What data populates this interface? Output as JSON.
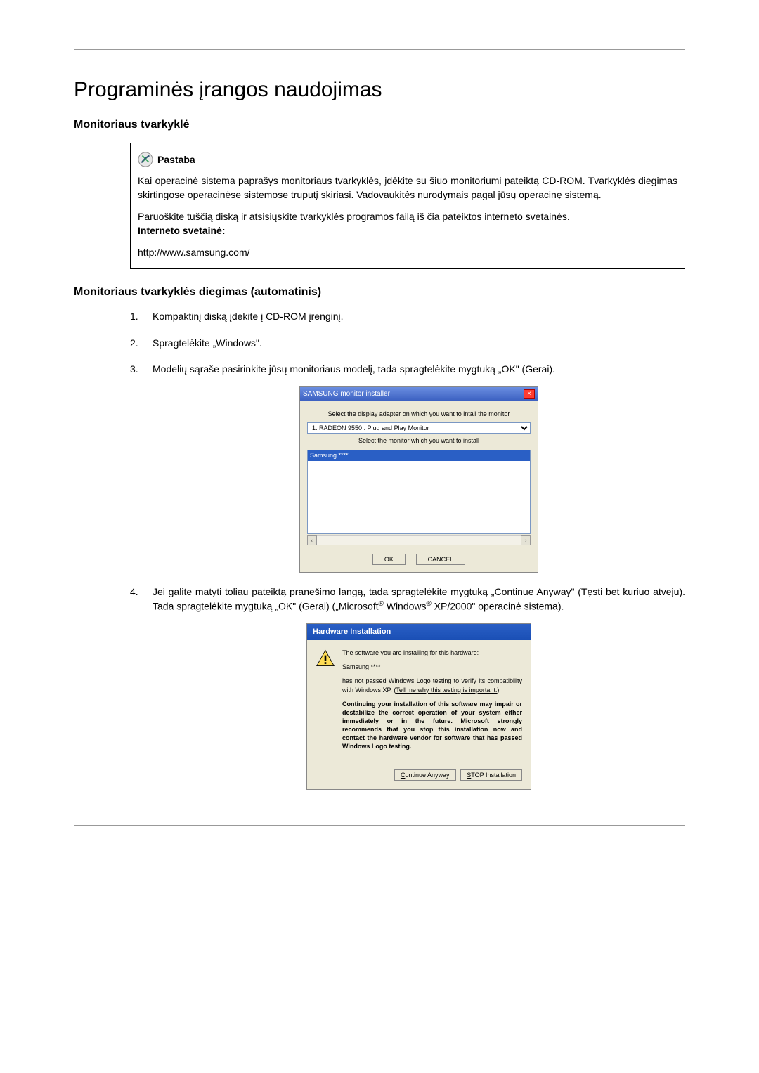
{
  "page_title": "Programinės įrangos naudojimas",
  "section1_heading": "Monitoriaus tvarkyklė",
  "note": {
    "title": "Pastaba",
    "para1": "Kai operacinė sistema paprašys monitoriaus tvarkyklės, įdėkite su šiuo monitoriumi pateiktą CD-ROM. Tvarkyklės diegimas skirtingose operacinėse sistemose truputį skiriasi. Vadovaukitės nurodymais pagal jūsų operacinę sistemą.",
    "para2": "Paruoškite tuščią diską ir atsisiųskite tvarkyklės programos failą iš čia pateiktos interneto svetainės.",
    "website_label": "Interneto svetainė:",
    "website_url": "http://www.samsung.com/"
  },
  "section2_heading": "Monitoriaus tvarkyklės diegimas (automatinis)",
  "steps": {
    "s1": "Kompaktinį diską įdėkite į CD-ROM įrenginį.",
    "s2": "Spragtelėkite „Windows\".",
    "s3": "Modelių sąraše pasirinkite jūsų monitoriaus modelį, tada spragtelėkite mygtuką „OK\" (Gerai).",
    "s4_a": "Jei galite matyti toliau pateiktą pranešimo langą, tada spragtelėkite mygtuką „Continue Anyway\" (Tęsti bet kuriuo atveju). Tada spragtelėkite mygtuką „OK\" (Gerai) („Microsoft",
    "s4_b": " Windows",
    "s4_c": " XP/2000\" operacinė sistema)."
  },
  "dlg_installer": {
    "title": "SAMSUNG monitor installer",
    "close": "×",
    "adapter_label": "Select the display adapter on which you want to intall the monitor",
    "adapter_option": "1. RADEON 9550 : Plug and Play Monitor",
    "monitor_label": "Select the monitor which you want to install",
    "monitor_item": "Samsung ****",
    "scroll_left": "‹",
    "scroll_right": "›",
    "ok": "OK",
    "cancel": "CANCEL"
  },
  "dlg_hardware": {
    "title": "Hardware Installation",
    "line1": "The software you are installing for this hardware:",
    "line2": "Samsung ****",
    "line3a": "has not passed Windows Logo testing to verify its compatibility with Windows XP. (",
    "line3_link": "Tell me why this testing is important.",
    "line3b": ")",
    "line4": "Continuing your installation of this software may impair or destabilize the correct operation of your system either immediately or in the future. Microsoft strongly recommends that you stop this installation now and contact the hardware vendor for software that has passed Windows Logo testing.",
    "btn_continue_u": "C",
    "btn_continue_rest": "ontinue Anyway",
    "btn_stop_u": "S",
    "btn_stop_rest": "TOP Installation"
  },
  "reg_mark": "®"
}
